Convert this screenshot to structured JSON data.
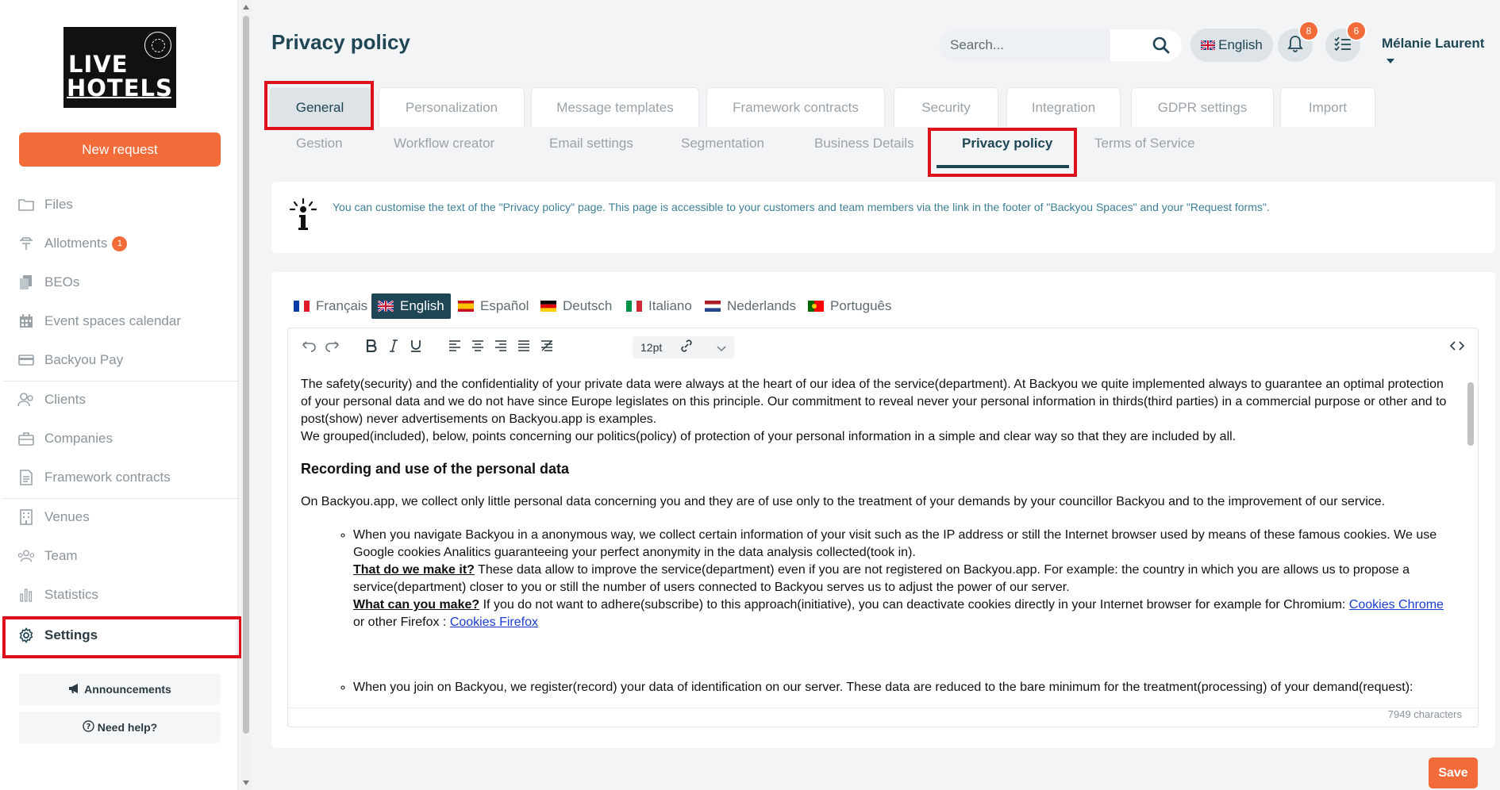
{
  "sidebar": {
    "logo": {
      "line1": "LIVE",
      "line2": "HOTELS"
    },
    "new_request": "New request",
    "items": [
      {
        "label": "Files"
      },
      {
        "label": "Allotments",
        "badge": "1"
      },
      {
        "label": "BEOs"
      },
      {
        "label": "Event spaces calendar"
      },
      {
        "label": "Backyou Pay"
      },
      {
        "label": "Clients"
      },
      {
        "label": "Companies"
      },
      {
        "label": "Framework contracts"
      },
      {
        "label": "Venues"
      },
      {
        "label": "Team"
      },
      {
        "label": "Statistics"
      },
      {
        "label": "Settings"
      }
    ],
    "announcements": "Announcements",
    "need_help": "Need help?"
  },
  "header": {
    "title": "Privacy policy",
    "search_placeholder": "Search...",
    "language": "English",
    "notifications_count": "8",
    "tasks_count": "6",
    "user": "Mélanie Laurent"
  },
  "tabs_primary": [
    "General",
    "Personalization",
    "Message templates",
    "Framework contracts",
    "Security",
    "Integration",
    "GDPR settings",
    "Import"
  ],
  "tabs_secondary": [
    "Gestion",
    "Workflow creator",
    "Email settings",
    "Segmentation",
    "Business Details",
    "Privacy policy",
    "Terms of Service"
  ],
  "info": "You can customise the text of the \"Privacy policy\" page. This page is accessible to your customers and team members via the link in the footer of \"Backyou Spaces\" and your \"Request forms\".",
  "languages": [
    "Français",
    "English",
    "Español",
    "Deutsch",
    "Italiano",
    "Nederlands",
    "Português"
  ],
  "editor": {
    "font_size": "12pt",
    "char_count": "7949 characters",
    "p1": "The safety(security) and the confidentiality of your private data were always at the heart of our idea of the service(department). At Backyou we quite implemented always to guarantee an optimal protection of your personal data and we do not have since Europe legislates on this principle. Our commitment to reveal never your personal information in thirds(third parties) in a commercial purpose or other and to post(show) never advertisements on Backyou.app is examples.",
    "p2": "We grouped(included), below, points concerning our politics(policy) of protection of your personal information in a simple and clear way so that they are included by all.",
    "h1": "Recording and use of  the personal data",
    "p3": "On Backyou.app, we collect only little personal data concerning you and they are of use only to the treatment of your demands by your councillor Backyou and to the improvement of our service.",
    "li1_text": "When you navigate Backyou in a anonymous way, we collect certain information of your visit such as the IP address or still the Internet browser used by means of these famous cookies. We use Google cookies Analitics guaranteeing your perfect anonymity in the data analysis collected(took in).",
    "li1_q1": "That do we make it?",
    "li1_a1": " These data allow to improve the service(department) even if you are not registered on Backyou.app. For example: the country in which you are allows us to propose a service(department) closer to you or still the number of users connected to Backyou serves us to adjust the power of our server.",
    "li1_q2": "What can you make?",
    "li1_a2": " If you do not want to adhere(subscribe) to this approach(initiative), you can deactivate cookies directly in your Internet browser for example for Chromium: ",
    "link1": "Cookies Chrome",
    "li1_mid": " or other Firefox : ",
    "link2": "Cookies Firefox",
    "li2_text": "When you join on Backyou, we register(record) your data of identification on our server. These data are reduced to the bare minimum for the treatment(processing) of your demand(request):"
  },
  "save": "Save",
  "colors": {
    "accent": "#f26b38",
    "primary": "#1f4654",
    "highlight": "#e00f1c"
  }
}
